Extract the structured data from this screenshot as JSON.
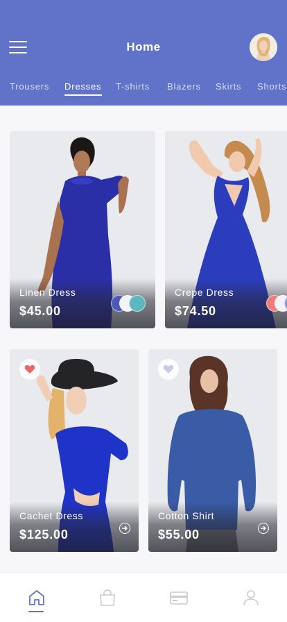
{
  "header": {
    "title": "Home",
    "menu_icon": "hamburger-menu-icon",
    "avatar": "user-avatar"
  },
  "tabs": [
    {
      "label": "Trousers",
      "active": false
    },
    {
      "label": "Dresses",
      "active": true
    },
    {
      "label": "T-shirts",
      "active": false
    },
    {
      "label": "Blazers",
      "active": false
    },
    {
      "label": "Skirts",
      "active": false
    },
    {
      "label": "Shorts",
      "active": false
    }
  ],
  "products": [
    {
      "name": "Linen Dress",
      "price": "$45.00",
      "swatches": [
        "#4b5ab8",
        "#f2f3f7",
        "#5bb8bd"
      ]
    },
    {
      "name": "Crepe Dress",
      "price": "$74.50",
      "swatches": [
        "#f07b7b",
        "#f2f3f7",
        "#8a9bd3"
      ]
    },
    {
      "name": "Cachet Dress",
      "price": "$125.00",
      "favorite": true
    },
    {
      "name": "Cotton Shirt",
      "price": "$55.00",
      "favorite": false
    }
  ],
  "bottom_nav": [
    {
      "icon": "home-icon",
      "active": true
    },
    {
      "icon": "shopping-bag-icon",
      "active": false
    },
    {
      "icon": "credit-card-icon",
      "active": false
    },
    {
      "icon": "user-profile-icon",
      "active": false
    }
  ],
  "colors": {
    "accent": "#6173c9",
    "favorite_active": "#f06466",
    "favorite_inactive": "#c7ccea"
  }
}
